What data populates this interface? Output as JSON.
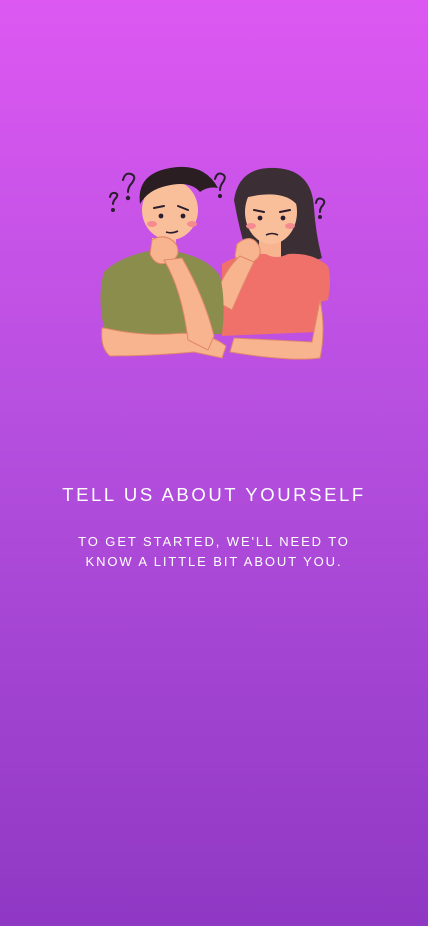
{
  "onboarding": {
    "illustration_icon": "two-people-thinking-question-marks",
    "title": "TELL US ABOUT YOURSELF",
    "subtitle": "TO GET STARTED, WE'LL NEED TO KNOW A LITTLE BIT ABOUT YOU."
  },
  "colors": {
    "gradient_top": "#dd58f2",
    "gradient_bottom": "#8f38c4",
    "text": "#ffffff"
  }
}
